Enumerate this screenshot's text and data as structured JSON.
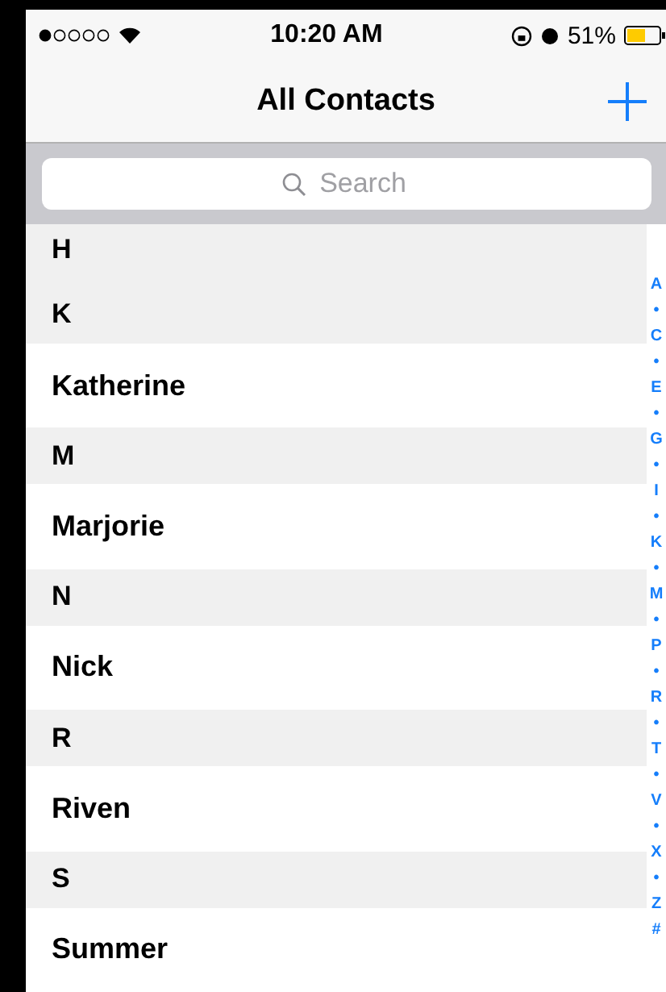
{
  "status_bar": {
    "time": "10:20 AM",
    "battery": "51%"
  },
  "nav_bar": {
    "title": "All Contacts"
  },
  "search": {
    "placeholder": "Search"
  },
  "sections": [
    {
      "header": "H"
    },
    {
      "header": "K",
      "contacts": [
        "Katherine"
      ]
    },
    {
      "header": "M",
      "contacts": [
        "Marjorie"
      ]
    },
    {
      "header": "N",
      "contacts": [
        "Nick"
      ]
    },
    {
      "header": "R",
      "contacts": [
        "Riven"
      ]
    },
    {
      "header": "S",
      "contacts": [
        "Summer"
      ]
    }
  ],
  "index": [
    "A",
    "•",
    "C",
    "•",
    "E",
    "•",
    "G",
    "•",
    "I",
    "•",
    "K",
    "•",
    "M",
    "•",
    "P",
    "•",
    "R",
    "•",
    "T",
    "•",
    "V",
    "•",
    "X",
    "•",
    "Z",
    "#"
  ]
}
